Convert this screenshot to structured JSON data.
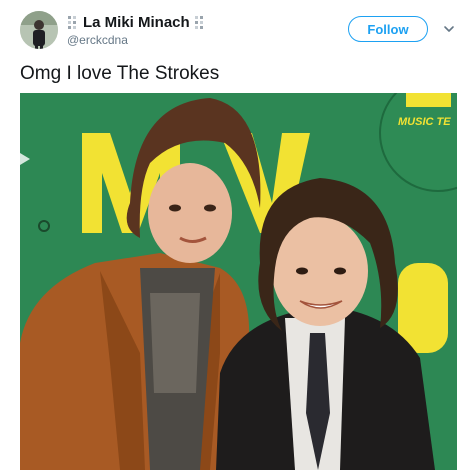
{
  "author": {
    "display_name": "La Miki Minach",
    "handle": "@erckcdna",
    "avatar_icon": "profile-photo"
  },
  "follow_button": {
    "label": "Follow"
  },
  "menu": {
    "icon": "chevron-down-icon"
  },
  "tweet": {
    "text": "Omg I love The Strokes"
  },
  "media": {
    "description_icon": "photo",
    "background_sign_text": "MUSIC TE",
    "colors": {
      "backdrop_green": "#2f8d58",
      "sign_yellow": "#f2e233",
      "accent_blue": "#1da1f2"
    }
  }
}
